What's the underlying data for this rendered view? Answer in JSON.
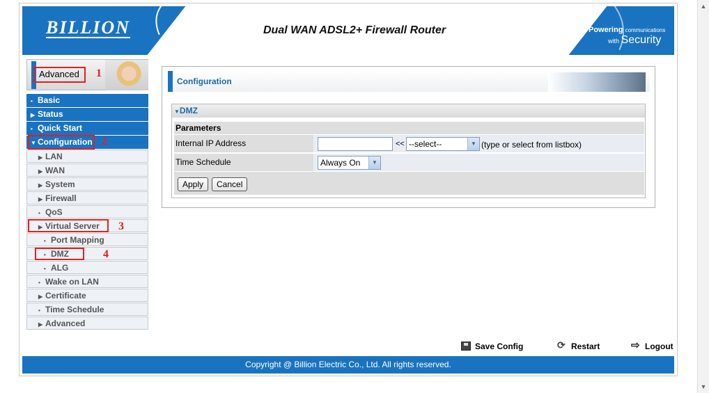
{
  "header": {
    "logo": "BILLION",
    "title": "Dual WAN ADSL2+ Firewall Router",
    "tagline_powering": "Powering",
    "tagline_comm": "communications",
    "tagline_with": "with",
    "tagline_security": "Security"
  },
  "sidebar": {
    "mode_label": "Advanced",
    "items": [
      {
        "label": "Basic",
        "level": "top",
        "glyph": "•"
      },
      {
        "label": "Status",
        "level": "top",
        "glyph": "▶"
      },
      {
        "label": "Quick Start",
        "level": "top",
        "glyph": "•"
      },
      {
        "label": "Configuration",
        "level": "top",
        "glyph": "▼"
      },
      {
        "label": "LAN",
        "level": "sub",
        "glyph": "▶"
      },
      {
        "label": "WAN",
        "level": "sub",
        "glyph": "▶"
      },
      {
        "label": "System",
        "level": "sub",
        "glyph": "▶"
      },
      {
        "label": "Firewall",
        "level": "sub",
        "glyph": "▶"
      },
      {
        "label": "QoS",
        "level": "sub",
        "glyph": "•"
      },
      {
        "label": "Virtual Server",
        "level": "sub",
        "glyph": "▶"
      },
      {
        "label": "Port Mapping",
        "level": "subsub",
        "glyph": "•"
      },
      {
        "label": "DMZ",
        "level": "subsub",
        "glyph": "•"
      },
      {
        "label": "ALG",
        "level": "subsub",
        "glyph": "•"
      },
      {
        "label": "Wake on LAN",
        "level": "sub",
        "glyph": "•"
      },
      {
        "label": "Certificate",
        "level": "sub",
        "glyph": "▶"
      },
      {
        "label": "Time Schedule",
        "level": "sub",
        "glyph": "•"
      },
      {
        "label": "Advanced",
        "level": "sub",
        "glyph": "▶"
      }
    ]
  },
  "annotations": {
    "n1": "1",
    "n2": "2",
    "n3": "3",
    "n4": "4"
  },
  "main": {
    "section_title": "Configuration",
    "dmz": {
      "title": "DMZ",
      "params_label": "Parameters",
      "internal_ip_label": "Internal IP Address",
      "internal_ip_value": "",
      "ltlt": "<<",
      "ip_select_value": "--select--",
      "hint": "(type or select from listbox)",
      "schedule_label": "Time Schedule",
      "schedule_value": "Always On",
      "apply_label": "Apply",
      "cancel_label": "Cancel"
    }
  },
  "actions": {
    "save_config": "Save Config",
    "restart": "Restart",
    "logout": "Logout"
  },
  "footer": {
    "copyright": "Copyright @ Billion Electric Co., Ltd. All rights reserved."
  },
  "colors": {
    "brand_blue": "#1a73c0",
    "annotation_red": "#e02020"
  }
}
